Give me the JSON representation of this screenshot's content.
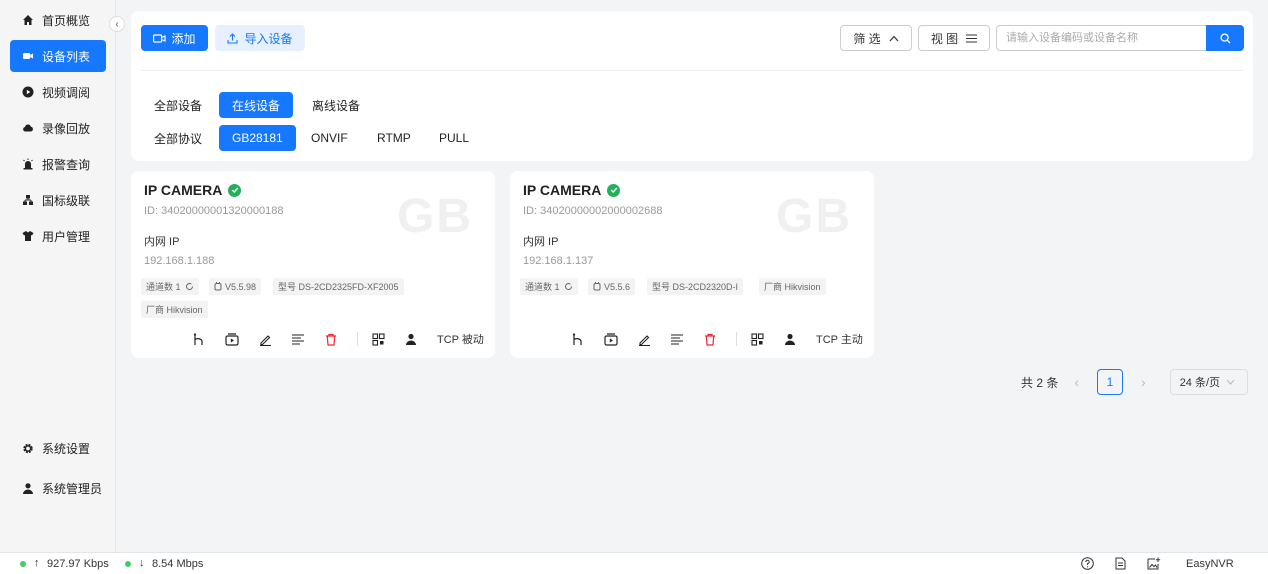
{
  "sidebar": {
    "items": [
      {
        "label": "首页概览",
        "icon": "home-icon"
      },
      {
        "label": "设备列表",
        "icon": "camera-icon"
      },
      {
        "label": "视频调阅",
        "icon": "play-circle-icon"
      },
      {
        "label": "录像回放",
        "icon": "cloud-icon"
      },
      {
        "label": "报警查询",
        "icon": "alarm-icon"
      },
      {
        "label": "国标级联",
        "icon": "cascade-icon"
      },
      {
        "label": "用户管理",
        "icon": "shirt-icon"
      }
    ],
    "bottom": [
      {
        "label": "系统设置",
        "icon": "gear-icon"
      },
      {
        "label": "系统管理员",
        "icon": "user-icon"
      }
    ],
    "collapse_glyph": "‹"
  },
  "toolbar": {
    "add_label": "添加",
    "import_label": "导入设备",
    "filter_label": "筛 选",
    "view_label": "视 图",
    "search_placeholder": "请输入设备编码或设备名称"
  },
  "status_filters": [
    "全部设备",
    "在线设备",
    "离线设备"
  ],
  "protocol_filters": [
    "全部协议",
    "GB28181",
    "ONVIF",
    "RTMP",
    "PULL"
  ],
  "devices": [
    {
      "name": "IP CAMERA",
      "id": "ID: 34020000001320000188",
      "ip_label": "内网 IP",
      "ip": "192.168.1.188",
      "channels": "通道数 1",
      "version": "V5.5.98",
      "model": "型号 DS-2CD2325FD-XF2005",
      "vendor": "厂商 Hikvision",
      "watermark": "GB",
      "transport": "TCP 被动"
    },
    {
      "name": "IP CAMERA",
      "id": "ID: 34020000002000002688",
      "ip_label": "内网 IP",
      "ip": "192.168.1.137",
      "channels": "通道数 1",
      "version": "V5.5.6",
      "model": "型号 DS-2CD2320D-I",
      "vendor": "厂商 Hikvision",
      "watermark": "GB",
      "transport": "TCP 主动"
    }
  ],
  "pagination": {
    "total": "共 2 条",
    "prev": "‹",
    "current": "1",
    "next": "›",
    "page_size": "24 条/页"
  },
  "statusbar": {
    "up": "927.97 Kbps",
    "down": "8.54 Mbps",
    "brand": "EasyNVR"
  },
  "colors": {
    "primary": "#1677ff",
    "online": "#22b05a",
    "danger": "#f5222d"
  }
}
